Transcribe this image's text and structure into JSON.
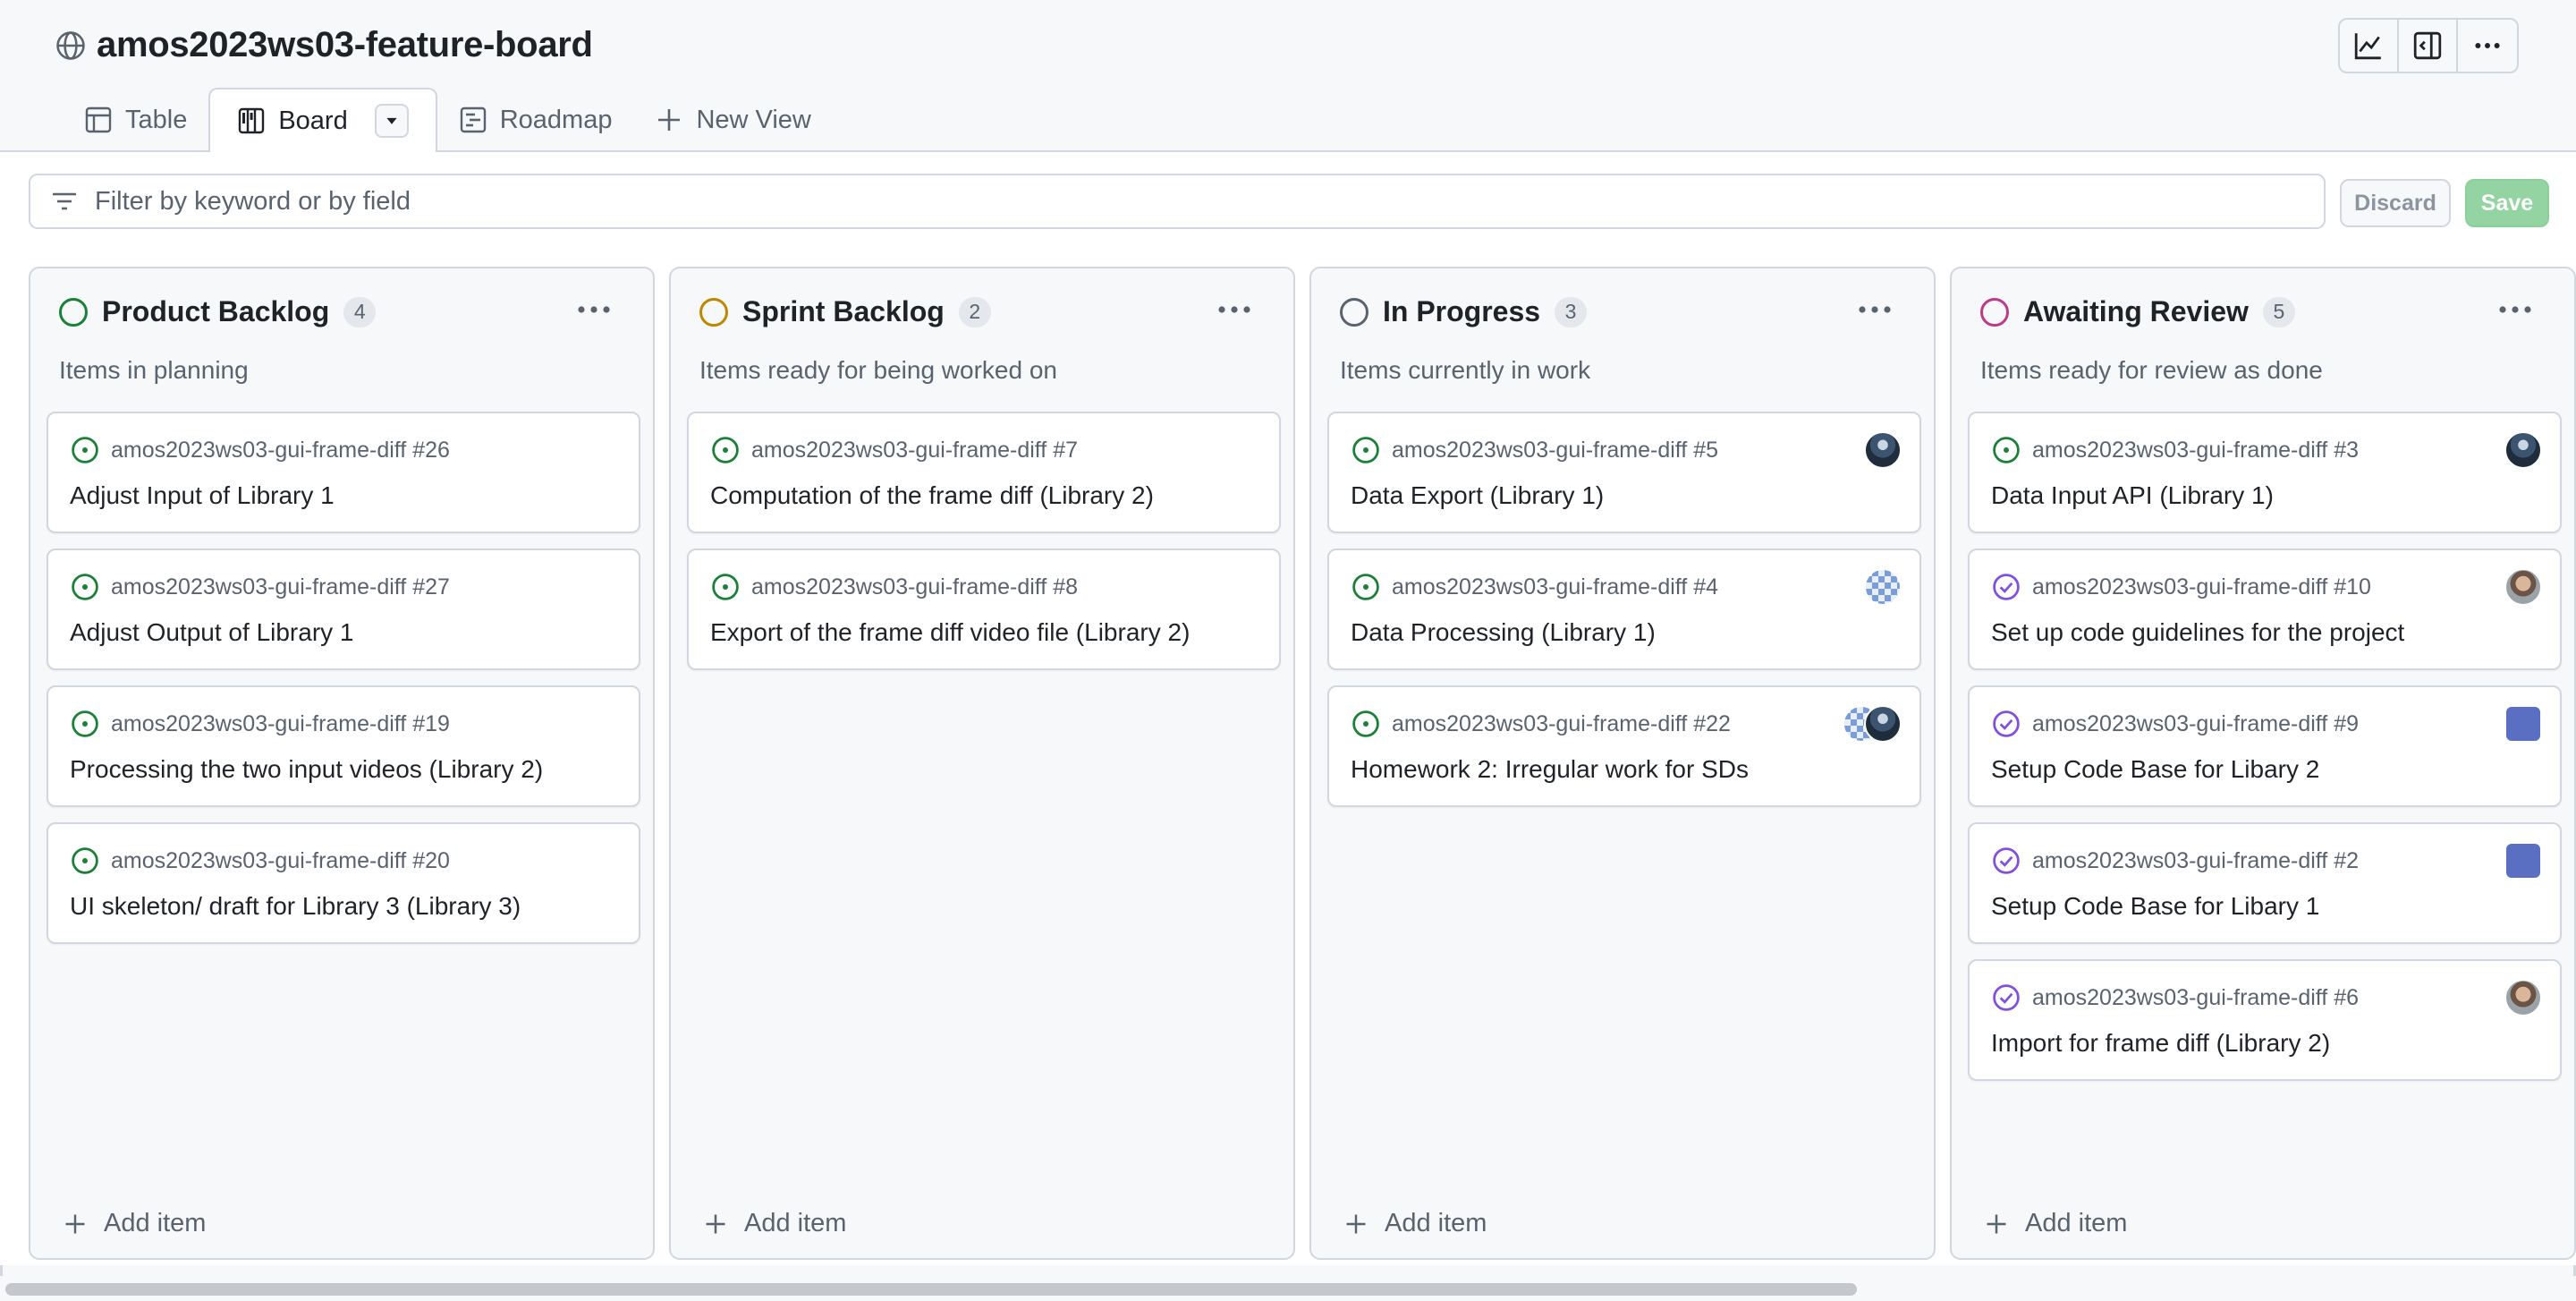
{
  "project": {
    "title": "amos2023ws03-feature-board"
  },
  "tabs": [
    {
      "label": "Table",
      "icon": "table-icon"
    },
    {
      "label": "Board",
      "icon": "board-icon",
      "active": true
    },
    {
      "label": "Roadmap",
      "icon": "roadmap-icon"
    },
    {
      "label": "New View",
      "icon": "plus-icon"
    }
  ],
  "filter": {
    "placeholder": "Filter by keyword or by field",
    "value": ""
  },
  "actions": {
    "discard_label": "Discard",
    "save_label": "Save"
  },
  "colors": {
    "green": "#1a7f37",
    "yellow": "#bf8700",
    "gray": "#59636e",
    "pink": "#bf3989",
    "purple": "#8250df",
    "save_bg": "#94d3a2"
  },
  "columns": [
    {
      "name": "Product Backlog",
      "count": "4",
      "description": "Items in planning",
      "status_color": "#1a7f37",
      "add_label": "Add item",
      "cards": [
        {
          "repo": "amos2023ws03-gui-frame-diff #26",
          "title": "Adjust Input of Library 1",
          "state": "open"
        },
        {
          "repo": "amos2023ws03-gui-frame-diff #27",
          "title": "Adjust Output of Library 1",
          "state": "open"
        },
        {
          "repo": "amos2023ws03-gui-frame-diff #19",
          "title": "Processing the two input videos (Library 2)",
          "state": "open"
        },
        {
          "repo": "amos2023ws03-gui-frame-diff #20",
          "title": "UI skeleton/ draft for Library 3 (Library 3)",
          "state": "open"
        }
      ]
    },
    {
      "name": "Sprint Backlog",
      "count": "2",
      "description": "Items ready for being worked on",
      "status_color": "#bf8700",
      "add_label": "Add item",
      "cards": [
        {
          "repo": "amos2023ws03-gui-frame-diff #7",
          "title": "Computation of the frame diff (Library 2)",
          "state": "open"
        },
        {
          "repo": "amos2023ws03-gui-frame-diff #8",
          "title": "Export of the frame diff video file (Library 2)",
          "state": "open"
        }
      ]
    },
    {
      "name": "In Progress",
      "count": "3",
      "description": "Items currently in work",
      "status_color": "#59636e",
      "add_label": "Add item",
      "cards": [
        {
          "repo": "amos2023ws03-gui-frame-diff #5",
          "title": "Data Export (Library 1)",
          "state": "open",
          "avatars": [
            "photo"
          ]
        },
        {
          "repo": "amos2023ws03-gui-frame-diff #4",
          "title": "Data Processing (Library 1)",
          "state": "open",
          "avatars": [
            "identicon"
          ]
        },
        {
          "repo": "amos2023ws03-gui-frame-diff #22",
          "title": "Homework 2: Irregular work for SDs",
          "state": "open",
          "avatars": [
            "identicon",
            "photo"
          ]
        }
      ]
    },
    {
      "name": "Awaiting Review",
      "count": "5",
      "description": "Items ready for review as done",
      "status_color": "#bf3989",
      "add_label": "Add item",
      "cards": [
        {
          "repo": "amos2023ws03-gui-frame-diff #3",
          "title": "Data Input API (Library 1)",
          "state": "open",
          "avatars": [
            "photo"
          ]
        },
        {
          "repo": "amos2023ws03-gui-frame-diff #10",
          "title": "Set up code guidelines for the project",
          "state": "closed",
          "avatars": [
            "face"
          ]
        },
        {
          "repo": "amos2023ws03-gui-frame-diff #9",
          "title": "Setup Code Base for Libary 2",
          "state": "closed",
          "avatars": [
            "robot"
          ]
        },
        {
          "repo": "amos2023ws03-gui-frame-diff #2",
          "title": "Setup Code Base for Libary 1",
          "state": "closed",
          "avatars": [
            "robot"
          ]
        },
        {
          "repo": "amos2023ws03-gui-frame-diff #6",
          "title": "Import for frame diff (Library 2)",
          "state": "closed",
          "avatars": [
            "face"
          ]
        }
      ]
    }
  ]
}
